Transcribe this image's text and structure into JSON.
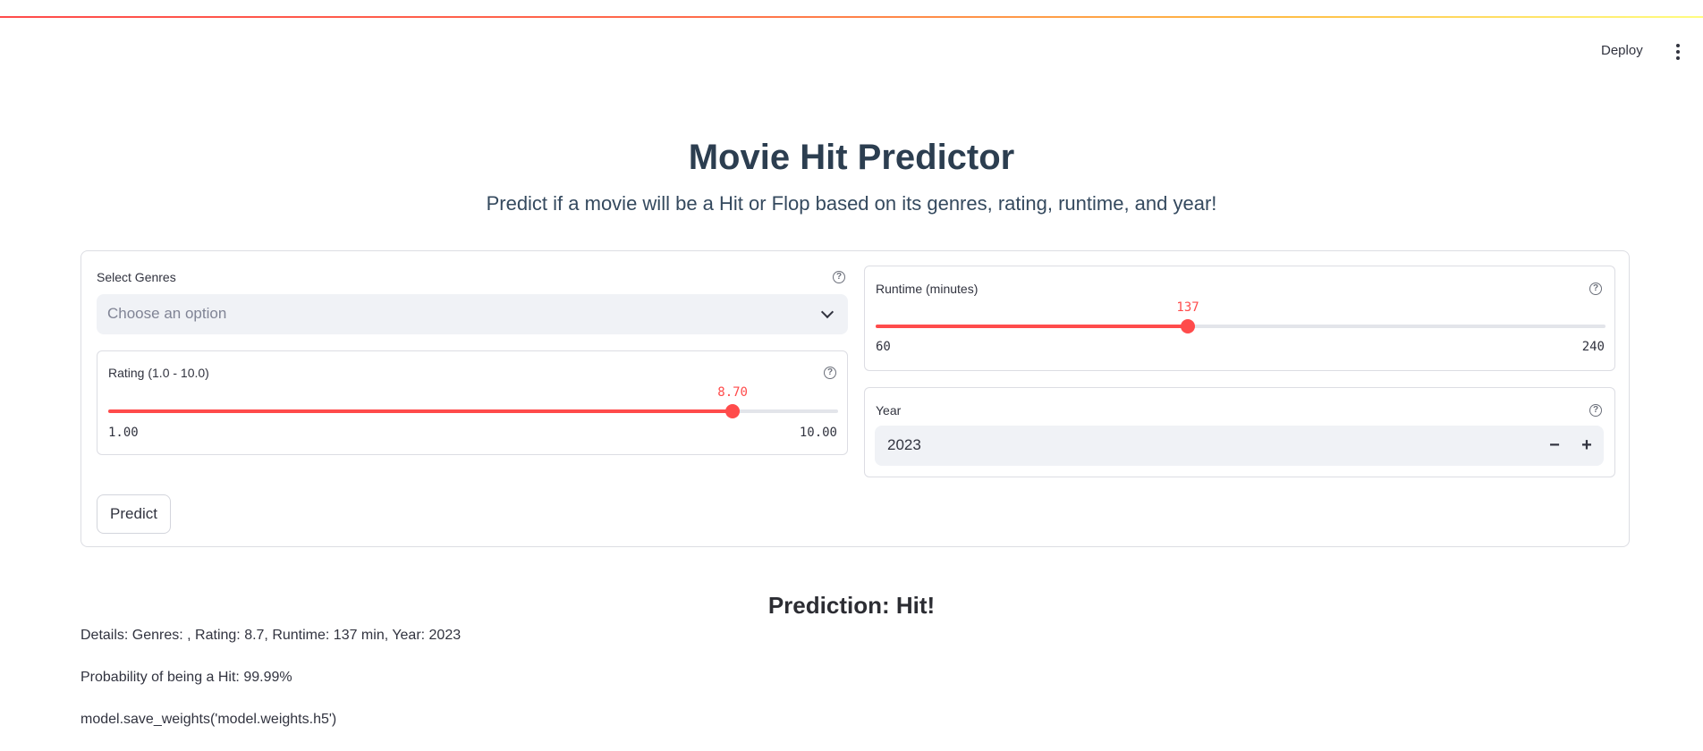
{
  "header": {
    "deploy_label": "Deploy",
    "menu_icon": "vertical-dots-icon"
  },
  "title": "Movie Hit Predictor",
  "subtitle": "Predict if a movie will be a Hit or Flop based on its genres, rating, runtime, and year!",
  "colors": {
    "accent": "#ff4b4b",
    "title": "#2c3e50",
    "input_bg": "#f0f2f6"
  },
  "form": {
    "genres": {
      "label": "Select Genres",
      "placeholder": "Choose an option",
      "help_icon": "question-circle-icon"
    },
    "rating": {
      "label": "Rating (1.0 - 10.0)",
      "value": 8.7,
      "value_text": "8.70",
      "min_text": "1.00",
      "max_text": "10.00",
      "min": 1,
      "max": 10
    },
    "runtime": {
      "label": "Runtime (minutes)",
      "value": 137,
      "value_text": "137",
      "min_text": "60",
      "max_text": "240",
      "min": 60,
      "max": 240
    },
    "year": {
      "label": "Year",
      "value": "2023",
      "minus": "−",
      "plus": "+"
    },
    "predict_label": "Predict"
  },
  "result": {
    "heading": "Prediction: Hit!",
    "details": "Details: Genres: , Rating: 8.7, Runtime: 137 min, Year: 2023",
    "probability": "Probability of being a Hit: 99.99%",
    "code_line": "model.save_weights('model.weights.h5')"
  }
}
